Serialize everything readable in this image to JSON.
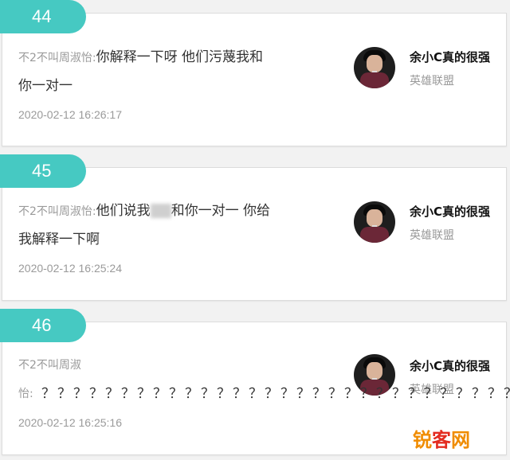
{
  "comments": [
    {
      "floor": "44",
      "sender": "不2不叫周淑怡:",
      "line1": "你解释一下呀 他们污蔑我和",
      "line2": "你一对一",
      "time": "2020-02-12 16:26:17",
      "author_name": "余小C真的很强",
      "author_game": "英雄联盟"
    },
    {
      "floor": "45",
      "sender": "不2不叫周淑怡:",
      "line1_pre": "他们说我",
      "line1_post": "和你一对一 你给",
      "line2": "我解释一下啊",
      "time": "2020-02-12 16:25:24",
      "author_name": "余小C真的很强",
      "author_game": "英雄联盟"
    },
    {
      "floor": "46",
      "sender_line1": "不2不叫周淑",
      "sender_line2": "怡:",
      "question_marks": "？？？？？？？？？？？？？？？？？？？？？？？？？？？？？？？？？？？？",
      "time": "2020-02-12 16:25:16",
      "author_name": "余小C真的很强",
      "author_game": "英雄联盟"
    }
  ],
  "watermark": {
    "part1": "锐",
    "part2": "客",
    "part3": "网"
  },
  "colors": {
    "badge": "#46c9c2",
    "watermark_orange": "#f08c00",
    "watermark_red": "#e32b1f"
  }
}
